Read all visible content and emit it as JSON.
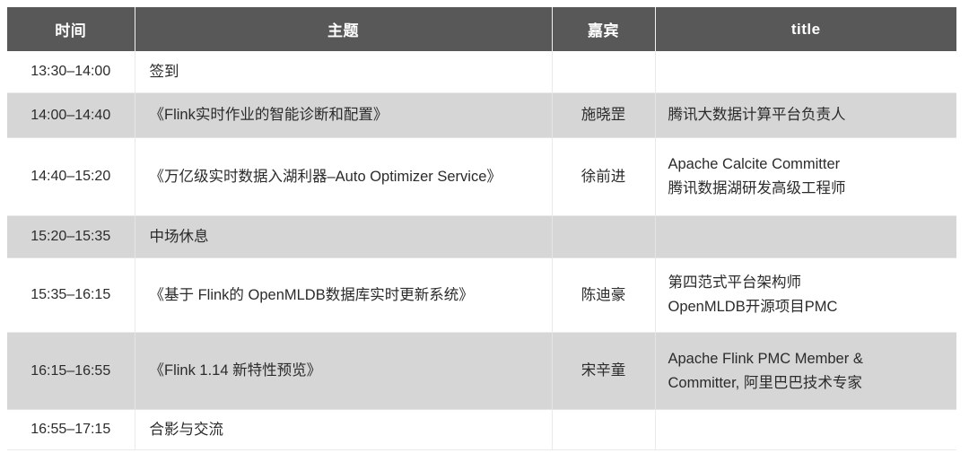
{
  "table": {
    "headers": [
      {
        "key": "time",
        "label": "时间"
      },
      {
        "key": "topic",
        "label": "主题"
      },
      {
        "key": "guest",
        "label": "嘉宾"
      },
      {
        "key": "title",
        "label": "title"
      }
    ],
    "header_bg": "#585858",
    "header_fg": "#ffffff",
    "shaded_row_bg": "#d6d6d6",
    "plain_row_bg": "#ffffff",
    "border_color": "#eaeaea",
    "rows": [
      {
        "time": "13:30–14:00",
        "topic": "签到",
        "guest": "",
        "title_line1": "",
        "title_line2": ""
      },
      {
        "time": "14:00–14:40",
        "topic": "《Flink实时作业的智能诊断和配置》",
        "guest": "施晓罡",
        "title_line1": "腾讯大数据计算平台负责人",
        "title_line2": ""
      },
      {
        "time": "14:40–15:20",
        "topic": "《万亿级实时数据入湖利器–Auto Optimizer Service》",
        "guest": "徐前进",
        "title_line1": "Apache Calcite Committer",
        "title_line2": "腾讯数据湖研发高级工程师"
      },
      {
        "time": "15:20–15:35",
        "topic": "中场休息",
        "guest": "",
        "title_line1": "",
        "title_line2": ""
      },
      {
        "time": "15:35–16:15",
        "topic": "《基于 Flink的 OpenMLDB数据库实时更新系统》",
        "guest": "陈迪豪",
        "title_line1": "第四范式平台架构师",
        "title_line2": "OpenMLDB开源项目PMC"
      },
      {
        "time": "16:15–16:55",
        "topic": "《Flink 1.14 新特性预览》",
        "guest": "宋辛童",
        "title_line1": "Apache Flink PMC Member &",
        "title_line2": "Committer, 阿里巴巴技术专家"
      },
      {
        "time": "16:55–17:15",
        "topic": "合影与交流",
        "guest": "",
        "title_line1": "",
        "title_line2": ""
      }
    ]
  }
}
